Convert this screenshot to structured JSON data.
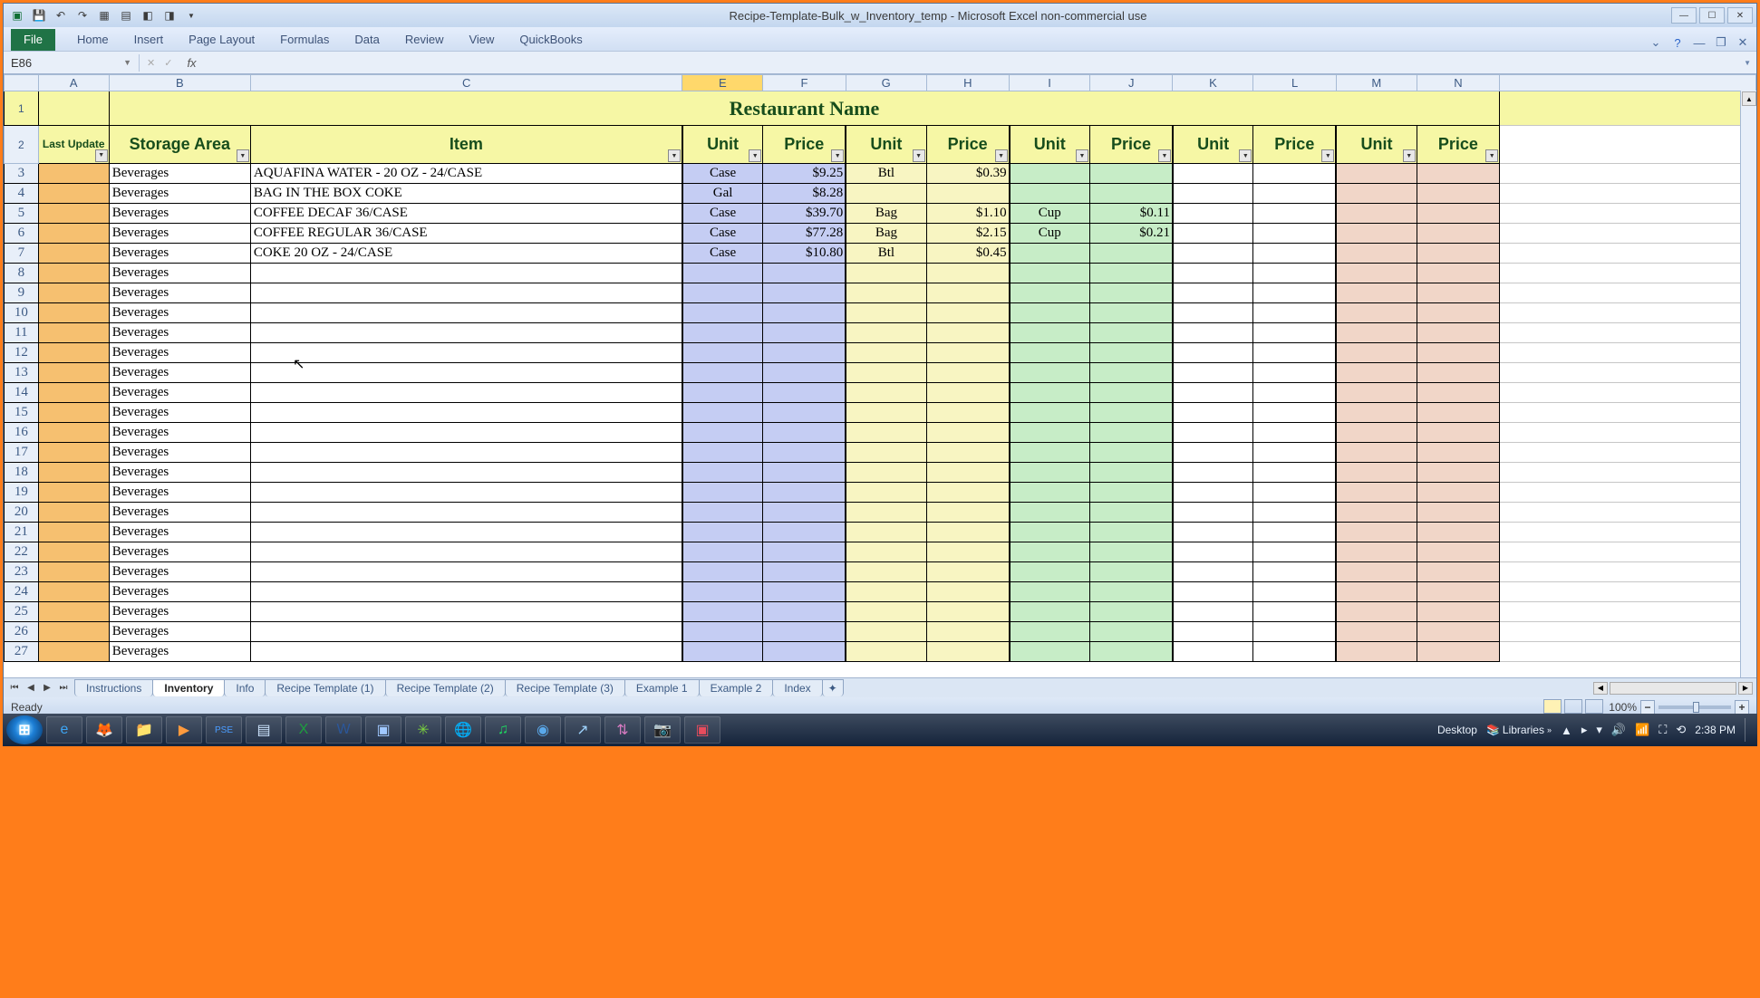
{
  "window": {
    "title": "Recipe-Template-Bulk_w_Inventory_temp - Microsoft Excel non-commercial use"
  },
  "ribbon_tabs": {
    "file": "File",
    "home": "Home",
    "insert": "Insert",
    "page_layout": "Page Layout",
    "formulas": "Formulas",
    "data": "Data",
    "review": "Review",
    "view": "View",
    "quickbooks": "QuickBooks"
  },
  "name_box": "E86",
  "columns": [
    "A",
    "B",
    "C",
    "E",
    "F",
    "G",
    "H",
    "I",
    "J",
    "K",
    "L",
    "M",
    "N"
  ],
  "selected_col": "E",
  "sheet_title": "Restaurant Name",
  "headers": {
    "last_updated": "Last Update",
    "storage": "Storage Area",
    "item": "Item",
    "unit": "Unit",
    "price": "Price"
  },
  "row_numbers": [
    1,
    2,
    3,
    4,
    5,
    6,
    7,
    8,
    9,
    10,
    11,
    12,
    13,
    14,
    15,
    16,
    17,
    18,
    19,
    20,
    21,
    22,
    23,
    24,
    25,
    26,
    27
  ],
  "rows": [
    {
      "storage": "Beverages",
      "item": "AQUAFINA WATER - 20 OZ - 24/CASE",
      "u1": "Case",
      "p1": "$9.25",
      "u2": "Btl",
      "p2": "$0.39",
      "u3": "",
      "p3": "",
      "u4": "",
      "p4": "",
      "u5": "",
      "p5": ""
    },
    {
      "storage": "Beverages",
      "item": "BAG IN THE BOX COKE",
      "u1": "Gal",
      "p1": "$8.28",
      "u2": "",
      "p2": "",
      "u3": "",
      "p3": "",
      "u4": "",
      "p4": "",
      "u5": "",
      "p5": ""
    },
    {
      "storage": "Beverages",
      "item": "COFFEE DECAF 36/CASE",
      "u1": "Case",
      "p1": "$39.70",
      "u2": "Bag",
      "p2": "$1.10",
      "u3": "Cup",
      "p3": "$0.11",
      "u4": "",
      "p4": "",
      "u5": "",
      "p5": ""
    },
    {
      "storage": "Beverages",
      "item": "COFFEE REGULAR 36/CASE",
      "u1": "Case",
      "p1": "$77.28",
      "u2": "Bag",
      "p2": "$2.15",
      "u3": "Cup",
      "p3": "$0.21",
      "u4": "",
      "p4": "",
      "u5": "",
      "p5": ""
    },
    {
      "storage": "Beverages",
      "item": "COKE 20 OZ - 24/CASE",
      "u1": "Case",
      "p1": "$10.80",
      "u2": "Btl",
      "p2": "$0.45",
      "u3": "",
      "p3": "",
      "u4": "",
      "p4": "",
      "u5": "",
      "p5": ""
    },
    {
      "storage": "Beverages",
      "item": "",
      "u1": "",
      "p1": "",
      "u2": "",
      "p2": "",
      "u3": "",
      "p3": "",
      "u4": "",
      "p4": "",
      "u5": "",
      "p5": ""
    },
    {
      "storage": "Beverages",
      "item": "",
      "u1": "",
      "p1": "",
      "u2": "",
      "p2": "",
      "u3": "",
      "p3": "",
      "u4": "",
      "p4": "",
      "u5": "",
      "p5": ""
    },
    {
      "storage": "Beverages",
      "item": "",
      "u1": "",
      "p1": "",
      "u2": "",
      "p2": "",
      "u3": "",
      "p3": "",
      "u4": "",
      "p4": "",
      "u5": "",
      "p5": ""
    },
    {
      "storage": "Beverages",
      "item": "",
      "u1": "",
      "p1": "",
      "u2": "",
      "p2": "",
      "u3": "",
      "p3": "",
      "u4": "",
      "p4": "",
      "u5": "",
      "p5": ""
    },
    {
      "storage": "Beverages",
      "item": "",
      "u1": "",
      "p1": "",
      "u2": "",
      "p2": "",
      "u3": "",
      "p3": "",
      "u4": "",
      "p4": "",
      "u5": "",
      "p5": ""
    },
    {
      "storage": "Beverages",
      "item": "",
      "u1": "",
      "p1": "",
      "u2": "",
      "p2": "",
      "u3": "",
      "p3": "",
      "u4": "",
      "p4": "",
      "u5": "",
      "p5": ""
    },
    {
      "storage": "Beverages",
      "item": "",
      "u1": "",
      "p1": "",
      "u2": "",
      "p2": "",
      "u3": "",
      "p3": "",
      "u4": "",
      "p4": "",
      "u5": "",
      "p5": ""
    },
    {
      "storage": "Beverages",
      "item": "",
      "u1": "",
      "p1": "",
      "u2": "",
      "p2": "",
      "u3": "",
      "p3": "",
      "u4": "",
      "p4": "",
      "u5": "",
      "p5": ""
    },
    {
      "storage": "Beverages",
      "item": "",
      "u1": "",
      "p1": "",
      "u2": "",
      "p2": "",
      "u3": "",
      "p3": "",
      "u4": "",
      "p4": "",
      "u5": "",
      "p5": ""
    },
    {
      "storage": "Beverages",
      "item": "",
      "u1": "",
      "p1": "",
      "u2": "",
      "p2": "",
      "u3": "",
      "p3": "",
      "u4": "",
      "p4": "",
      "u5": "",
      "p5": ""
    },
    {
      "storage": "Beverages",
      "item": "",
      "u1": "",
      "p1": "",
      "u2": "",
      "p2": "",
      "u3": "",
      "p3": "",
      "u4": "",
      "p4": "",
      "u5": "",
      "p5": ""
    },
    {
      "storage": "Beverages",
      "item": "",
      "u1": "",
      "p1": "",
      "u2": "",
      "p2": "",
      "u3": "",
      "p3": "",
      "u4": "",
      "p4": "",
      "u5": "",
      "p5": ""
    },
    {
      "storage": "Beverages",
      "item": "",
      "u1": "",
      "p1": "",
      "u2": "",
      "p2": "",
      "u3": "",
      "p3": "",
      "u4": "",
      "p4": "",
      "u5": "",
      "p5": ""
    },
    {
      "storage": "Beverages",
      "item": "",
      "u1": "",
      "p1": "",
      "u2": "",
      "p2": "",
      "u3": "",
      "p3": "",
      "u4": "",
      "p4": "",
      "u5": "",
      "p5": ""
    },
    {
      "storage": "Beverages",
      "item": "",
      "u1": "",
      "p1": "",
      "u2": "",
      "p2": "",
      "u3": "",
      "p3": "",
      "u4": "",
      "p4": "",
      "u5": "",
      "p5": ""
    },
    {
      "storage": "Beverages",
      "item": "",
      "u1": "",
      "p1": "",
      "u2": "",
      "p2": "",
      "u3": "",
      "p3": "",
      "u4": "",
      "p4": "",
      "u5": "",
      "p5": ""
    },
    {
      "storage": "Beverages",
      "item": "",
      "u1": "",
      "p1": "",
      "u2": "",
      "p2": "",
      "u3": "",
      "p3": "",
      "u4": "",
      "p4": "",
      "u5": "",
      "p5": ""
    },
    {
      "storage": "Beverages",
      "item": "",
      "u1": "",
      "p1": "",
      "u2": "",
      "p2": "",
      "u3": "",
      "p3": "",
      "u4": "",
      "p4": "",
      "u5": "",
      "p5": ""
    },
    {
      "storage": "Beverages",
      "item": "",
      "u1": "",
      "p1": "",
      "u2": "",
      "p2": "",
      "u3": "",
      "p3": "",
      "u4": "",
      "p4": "",
      "u5": "",
      "p5": ""
    },
    {
      "storage": "Beverages",
      "item": "",
      "u1": "",
      "p1": "",
      "u2": "",
      "p2": "",
      "u3": "",
      "p3": "",
      "u4": "",
      "p4": "",
      "u5": "",
      "p5": ""
    }
  ],
  "sheet_tabs": [
    "Instructions",
    "Inventory",
    "Info",
    "Recipe Template (1)",
    "Recipe Template (2)",
    "Recipe Template (3)",
    "Example 1",
    "Example 2",
    "Index"
  ],
  "active_sheet": 1,
  "status": {
    "ready": "Ready",
    "zoom": "100%"
  },
  "taskbar": {
    "desktop": "Desktop",
    "libraries": "Libraries",
    "time": "2:38 PM"
  }
}
